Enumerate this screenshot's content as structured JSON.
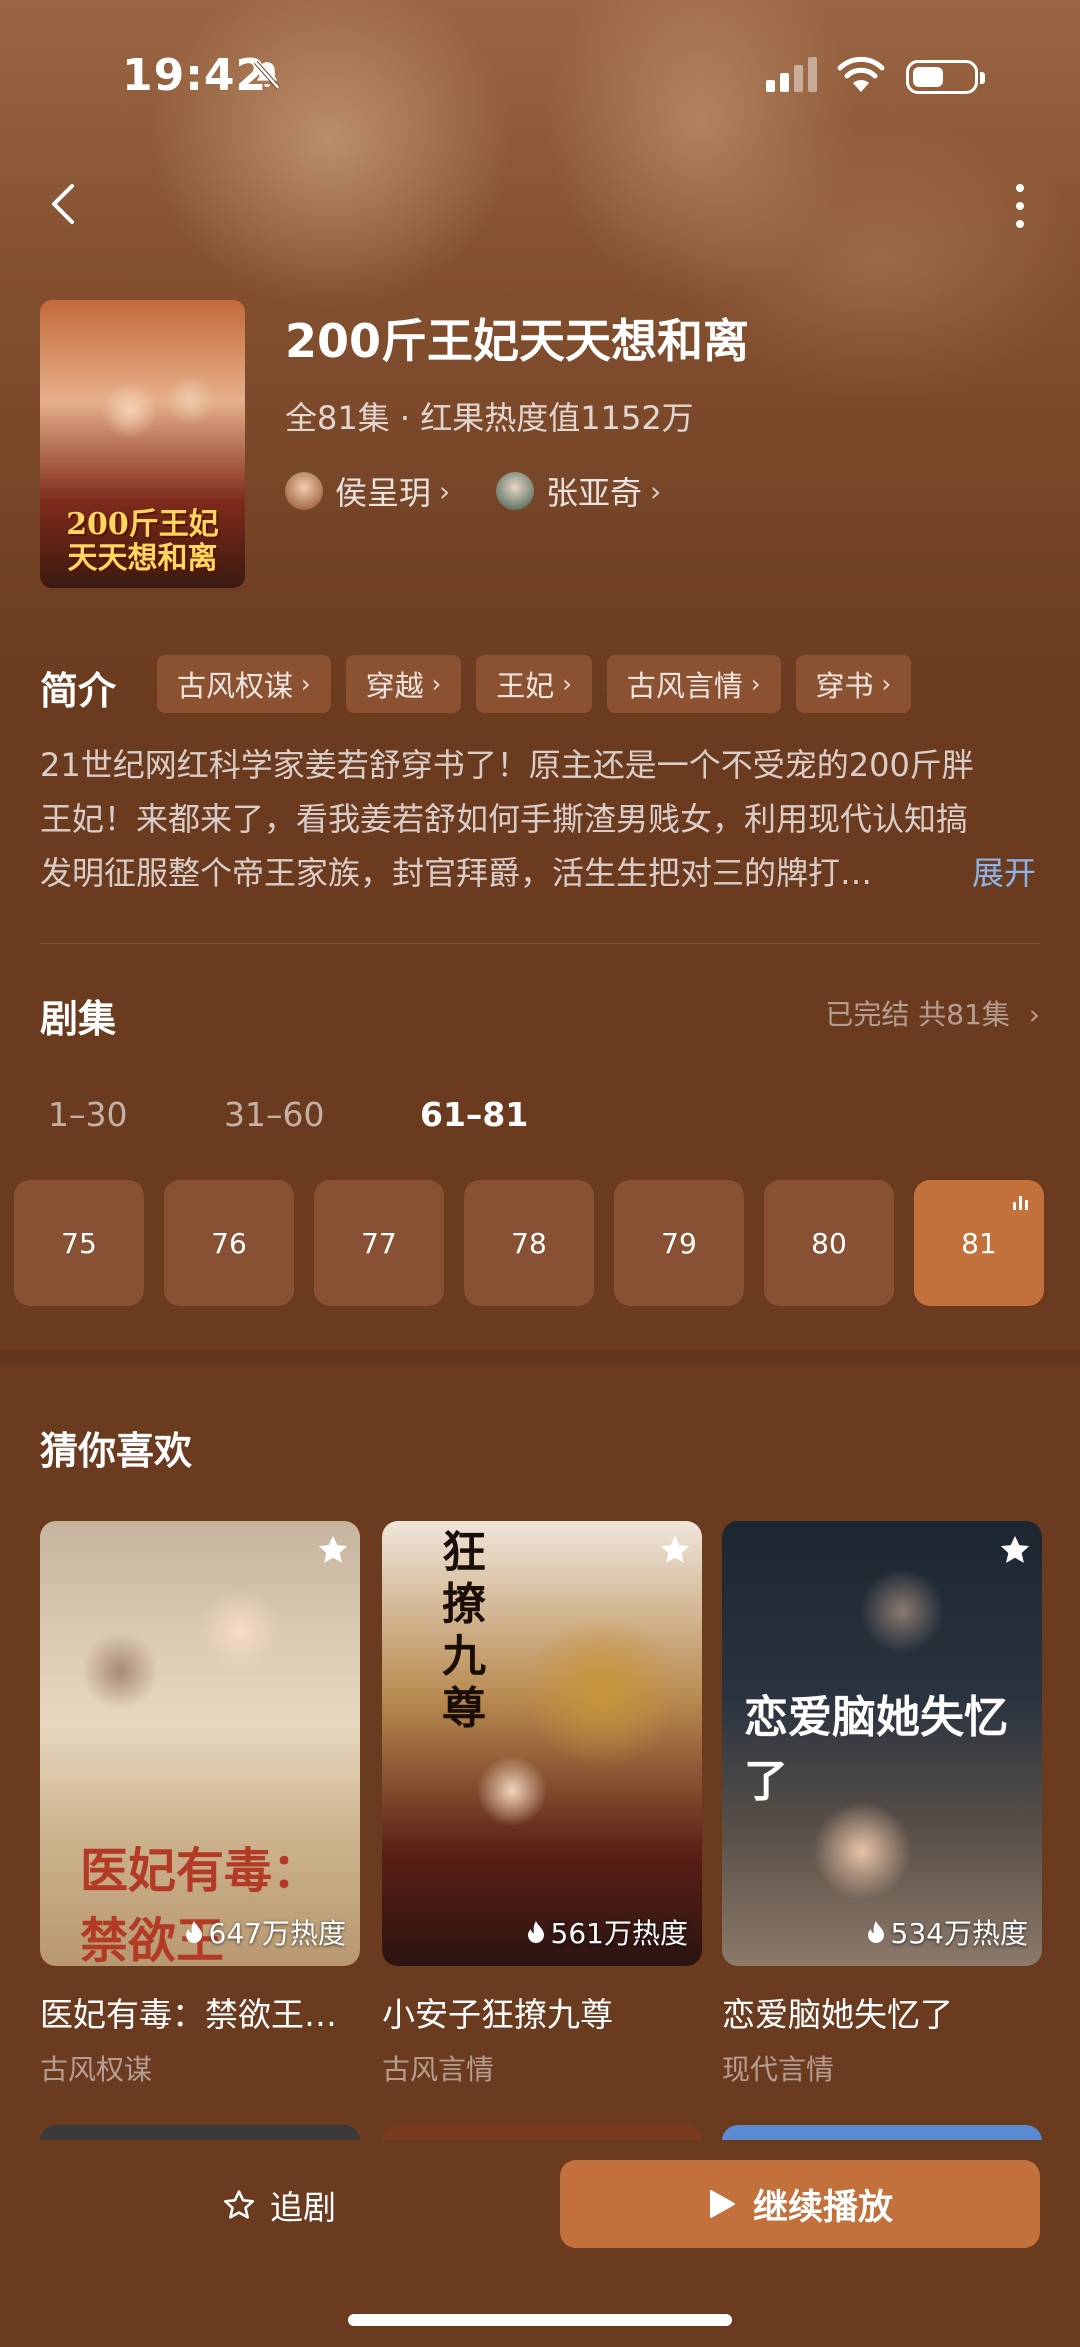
{
  "status_bar": {
    "time": "19:42"
  },
  "drama": {
    "title": "200斤王妃天天想和离",
    "meta": "全81集 · 红果热度值1152万",
    "actors": [
      {
        "name": "侯呈玥"
      },
      {
        "name": "张亚奇"
      }
    ],
    "poster_text": "200斤王妃 天天想和离"
  },
  "intro": {
    "label": "简介",
    "tags": [
      "古风权谋",
      "穿越",
      "王妃",
      "古风言情",
      "穿书"
    ],
    "lines": [
      "21世纪网红科学家姜若舒穿书了！原主还是一个不受宠的200斤胖",
      "王妃！来都来了，看我姜若舒如何手撕渣男贱女，利用现代认知搞",
      "发明征服整个帝王家族，封官拜爵，活生生把对三的牌打…"
    ],
    "expand_label": "展开"
  },
  "episodes": {
    "title": "剧集",
    "status": "已完结 共81集",
    "ranges": [
      "1–30",
      "31–60",
      "61–81"
    ],
    "active_range": "61–81",
    "items": [
      "75",
      "76",
      "77",
      "78",
      "79",
      "80",
      "81"
    ],
    "playing": "81"
  },
  "recommend": {
    "title": "猜你喜欢",
    "items": [
      {
        "name": "医妃有毒：禁欲王…",
        "genre": "古风权谋",
        "heat": "647万热度",
        "cover_text": "医妃有毒：禁欲王"
      },
      {
        "name": "小安子狂撩九尊",
        "genre": "古风言情",
        "heat": "561万热度",
        "cover_text": "狂撩九尊"
      },
      {
        "name": "恋爱脑她失忆了",
        "genre": "现代言情",
        "heat": "534万热度",
        "cover_text": "恋爱脑她失忆了"
      }
    ]
  },
  "bottom_bar": {
    "follow_label": "追剧",
    "play_label": "继续播放"
  },
  "colors": {
    "background": "#6b3b20",
    "accent": "#c2713d",
    "link": "#8eb4e8"
  },
  "icons": [
    "bell-slash-icon",
    "signal-icon",
    "wifi-icon",
    "battery-icon",
    "back-arrow-icon",
    "more-vertical-icon",
    "star-icon",
    "flame-icon",
    "play-icon",
    "playing-bars-icon"
  ]
}
